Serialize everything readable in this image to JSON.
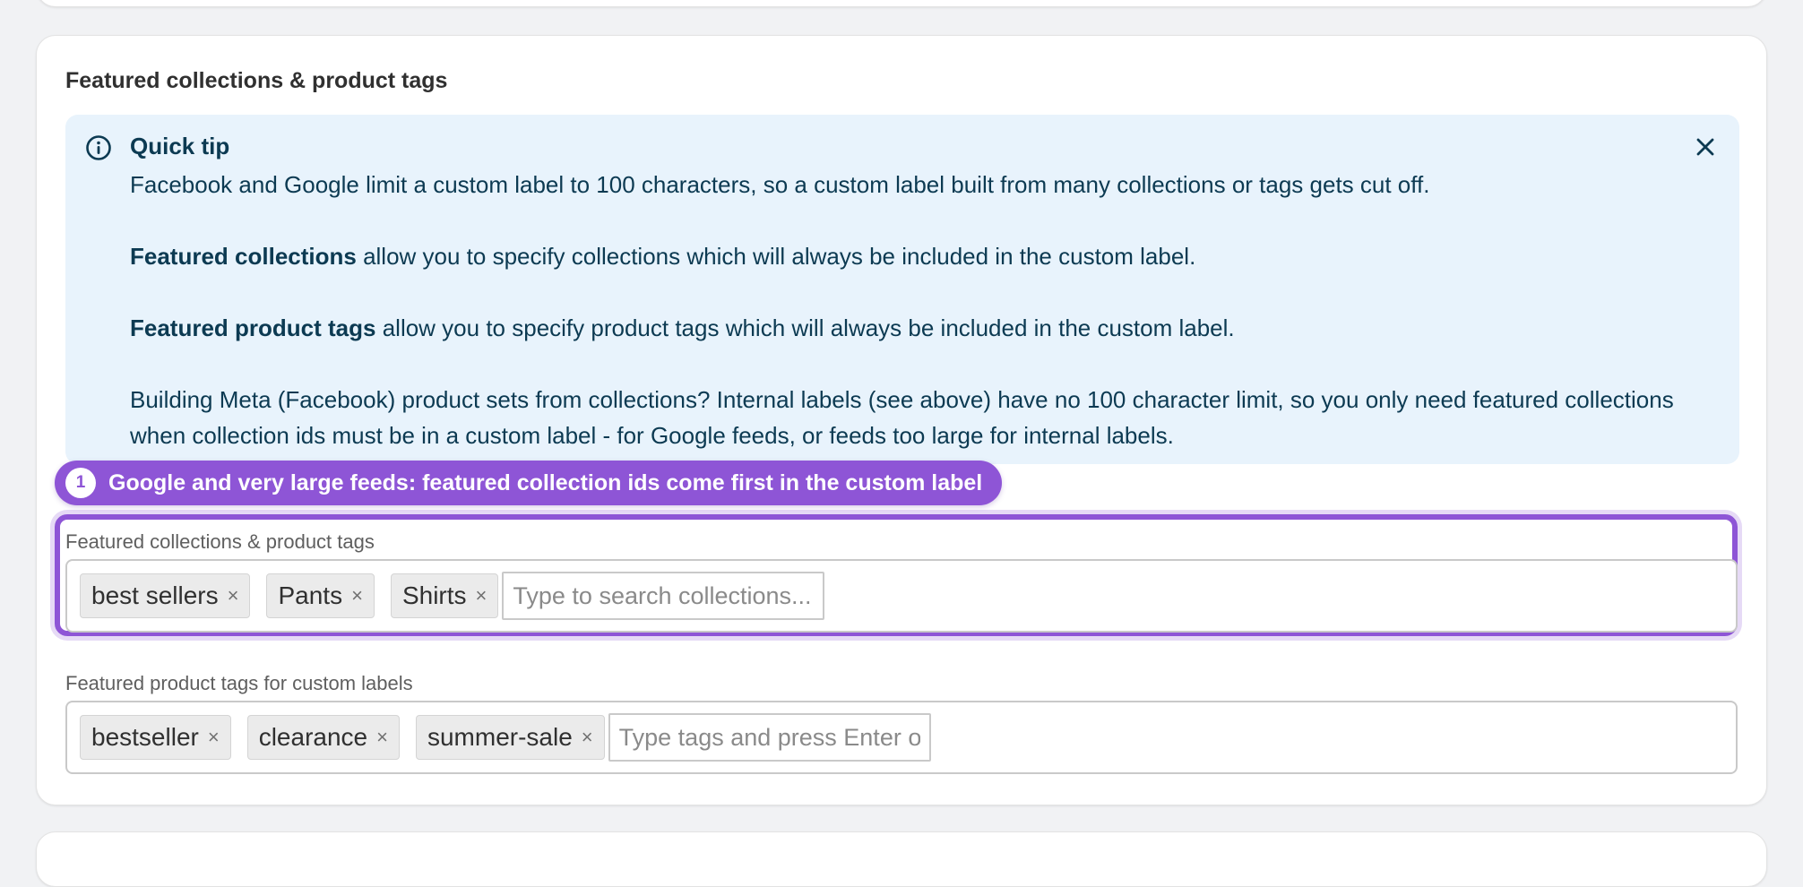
{
  "section": {
    "title": "Featured collections & product tags"
  },
  "banner": {
    "title": "Quick tip",
    "line1": "Facebook and Google limit a custom label to 100 characters, so a custom label built from many collections or tags gets cut off.",
    "collections_bold": "Featured collections",
    "collections_rest": " allow you to specify collections which will always be included in the custom label.",
    "tags_bold": "Featured product tags",
    "tags_rest": " allow you to specify product tags which will always be included in the custom label.",
    "meta_note": "Building Meta (Facebook) product sets from collections? Internal labels (see above) have no 100 character limit, so you only need featured collections when collection ids must be in a custom label - for Google feeds, or feeds too large for internal labels.",
    "icon": "info-icon",
    "close_icon": "close-icon"
  },
  "annotation": {
    "number": "1",
    "text": "Google and very large feeds: featured collection ids come first in the custom label",
    "color": "#8e55d6"
  },
  "collections_field": {
    "label": "Featured collections & product tags",
    "tags": [
      "best sellers",
      "Pants",
      "Shirts"
    ],
    "remove_glyph": "×",
    "placeholder": "Type to search collections..."
  },
  "tags_field": {
    "label": "Featured product tags for custom labels",
    "tags": [
      "bestseller",
      "clearance",
      "summer-sale"
    ],
    "remove_glyph": "×",
    "placeholder": "Type tags and press Enter or comma"
  }
}
